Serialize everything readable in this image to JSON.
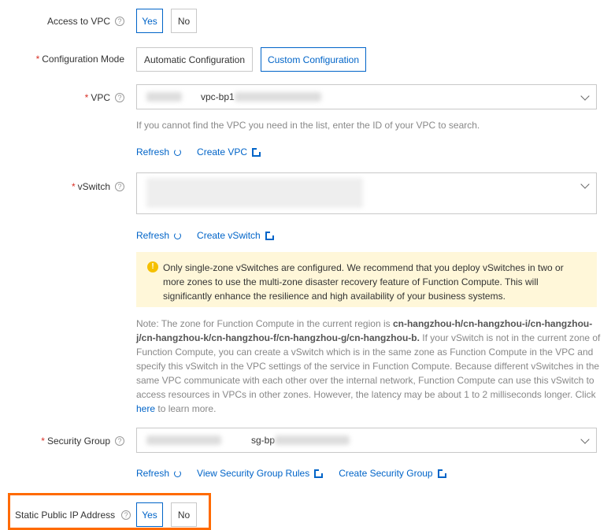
{
  "access_vpc": {
    "label": "Access to VPC",
    "yes": "Yes",
    "no": "No",
    "selected": "Yes"
  },
  "config_mode": {
    "label": "Configuration Mode",
    "automatic": "Automatic Configuration",
    "custom": "Custom Configuration",
    "selected": "Custom Configuration"
  },
  "vpc": {
    "label": "VPC",
    "value_prefix": "vpc-bp1",
    "help": "If you cannot find the VPC you need in the list, enter the ID of your VPC to search.",
    "refresh": "Refresh",
    "create": "Create VPC"
  },
  "vswitch": {
    "label": "vSwitch",
    "refresh": "Refresh",
    "create": "Create vSwitch"
  },
  "warning": {
    "text": "Only single-zone vSwitches are configured. We recommend that you deploy vSwitches in two or more zones to use the multi-zone disaster recovery feature of Function Compute. This will significantly enhance the resilience and high availability of your business systems."
  },
  "note": {
    "prefix": "Note: The zone for Function Compute in the current region is ",
    "zones": "cn-hangzhou-h/cn-hangzhou-i/cn-hangzhou-j/cn-hangzhou-k/cn-hangzhou-f/cn-hangzhou-g/cn-hangzhou-b.",
    "body": " If your vSwitch is not in the current zone of Function Compute, you can create a vSwitch which is in the same zone as Function Compute in the VPC and specify this vSwitch in the VPC settings of the service in Function Compute. Because different vSwitches in the same VPC communicate with each other over the internal network, Function Compute can use this vSwitch to access resources in VPCs in other zones. However, the latency may be about 1 to 2 milliseconds longer. Click ",
    "link": "here",
    "suffix": " to learn more."
  },
  "security_group": {
    "label": "Security Group",
    "value_prefix": "sg-bp",
    "refresh": "Refresh",
    "view_rules": "View Security Group Rules",
    "create": "Create Security Group"
  },
  "static_ip": {
    "label": "Static Public IP Address",
    "yes": "Yes",
    "no": "No",
    "selected": "Yes"
  },
  "colors": {
    "primary": "#0064c8",
    "highlight": "#ff6a00",
    "warning_bg": "#fff7d9"
  }
}
